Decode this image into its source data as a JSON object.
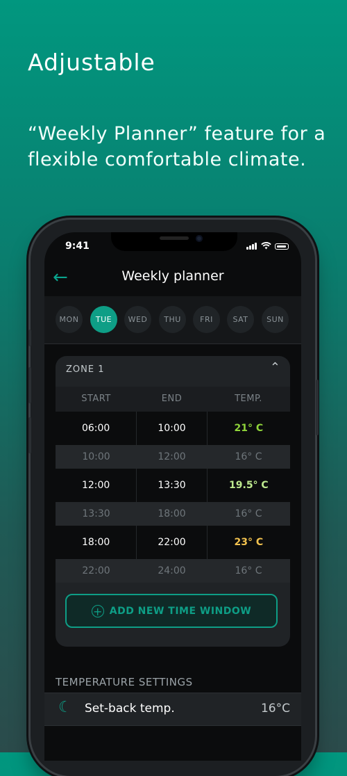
{
  "marketing": {
    "headline": "Adjustable",
    "subline": "“Weekly Planner” feature for a flexible comfortable climate."
  },
  "status_bar": {
    "time": "9:41"
  },
  "header": {
    "title": "Weekly planner"
  },
  "days": [
    {
      "label": "MON",
      "active": false
    },
    {
      "label": "TUE",
      "active": true
    },
    {
      "label": "WED",
      "active": false
    },
    {
      "label": "THU",
      "active": false
    },
    {
      "label": "FRI",
      "active": false
    },
    {
      "label": "SAT",
      "active": false
    },
    {
      "label": "SUN",
      "active": false
    }
  ],
  "zone": {
    "title": "ZONE 1",
    "columns": [
      "START",
      "END",
      "TEMP."
    ],
    "rows": [
      {
        "start": "06:00",
        "end": "10:00",
        "temp": "21° C",
        "active": true
      },
      {
        "start": "10:00",
        "end": "12:00",
        "temp": "16° C",
        "active": false
      },
      {
        "start": "12:00",
        "end": "13:30",
        "temp": "19.5° C",
        "active": true
      },
      {
        "start": "13:30",
        "end": "18:00",
        "temp": "16° C",
        "active": false
      },
      {
        "start": "18:00",
        "end": "22:00",
        "temp": "23° C",
        "active": true
      },
      {
        "start": "22:00",
        "end": "24:00",
        "temp": "16° C",
        "active": false
      }
    ],
    "add_label": "ADD NEW TIME WINDOW"
  },
  "temperature_settings": {
    "section_title": "TEMPERATURE SETTINGS",
    "setback_label": "Set-back temp.",
    "setback_value": "16°C"
  },
  "colors": {
    "accent": "#0e9e86",
    "temp_21": "#8fd43a",
    "temp_19_5": "#bde98e",
    "temp_23": "#f2c24f"
  }
}
